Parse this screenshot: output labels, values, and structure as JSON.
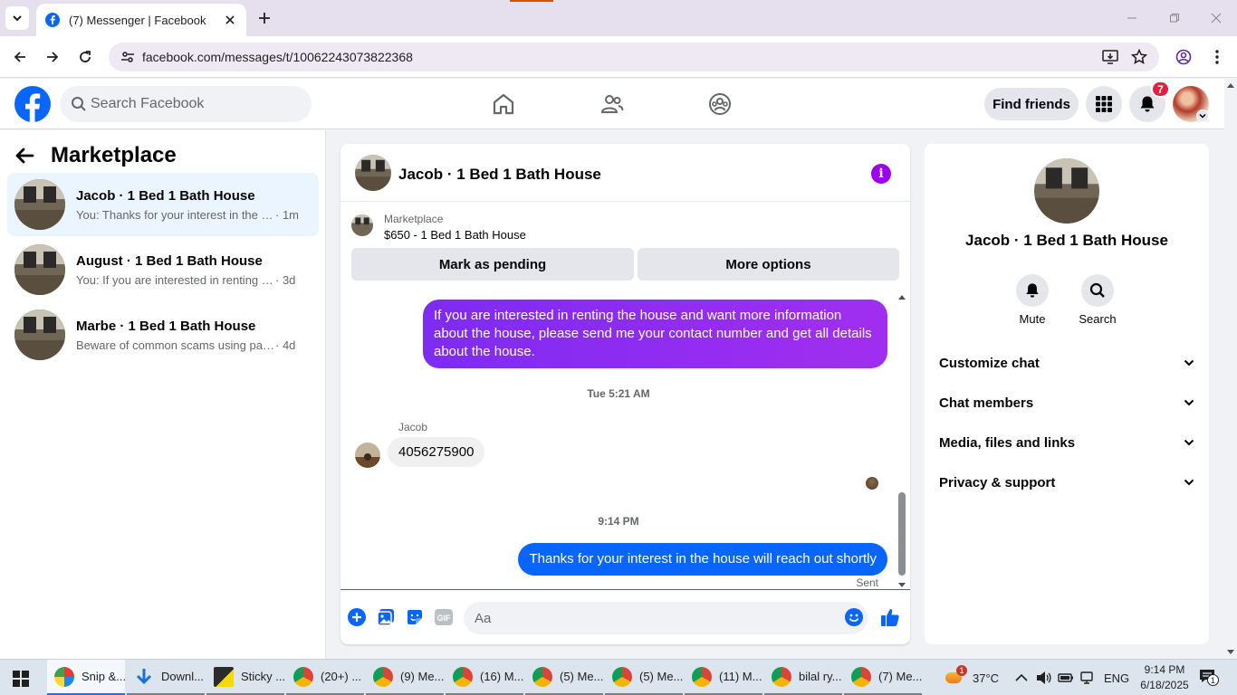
{
  "browser": {
    "tab_title": "(7) Messenger | Facebook",
    "url": "facebook.com/messages/t/10062243073822368"
  },
  "header": {
    "search_placeholder": "Search Facebook",
    "find_friends_label": "Find friends",
    "notifications_count": "7"
  },
  "sidebar": {
    "title": "Marketplace",
    "conversations": [
      {
        "name": "Jacob · 1 Bed 1 Bath House",
        "snippet": "You: Thanks for your interest in the h...",
        "time": "· 1m",
        "active": true
      },
      {
        "name": "August · 1 Bed 1 Bath House",
        "snippet": "You: If you are interested in renting th...",
        "time": "· 3d",
        "active": false
      },
      {
        "name": "Marbe · 1 Bed 1 Bath House",
        "snippet": "Beware of common scams using pay...",
        "time": "· 4d",
        "active": false
      }
    ]
  },
  "chat": {
    "title": "Jacob · 1 Bed 1 Bath House",
    "listing_label": "Marketplace",
    "listing_price": "$650 - 1 Bed 1 Bath House",
    "mark_pending_label": "Mark as pending",
    "more_options_label": "More options",
    "messages": {
      "outgoing_1": "If you are interested in renting the house and want more information about the house, please send me your contact number and get all details about the house.",
      "timestamp_1": "Tue 5:21 AM",
      "incoming_sender": "Jacob",
      "incoming_1": "4056275900",
      "timestamp_2": "9:14 PM",
      "outgoing_2": "Thanks for your interest in the house will reach out shortly",
      "status": "Sent"
    },
    "composer_placeholder": "Aa"
  },
  "details": {
    "name": "Jacob · 1 Bed 1 Bath House",
    "mute_label": "Mute",
    "search_label": "Search",
    "sections": [
      "Customize chat",
      "Chat members",
      "Media, files and links",
      "Privacy & support"
    ]
  },
  "taskbar": {
    "items": [
      "Snip &...",
      "Downl...",
      "Sticky ...",
      "(20+) ...",
      "(9) Me...",
      "(16) M...",
      "(5) Me...",
      "(5) Me...",
      "(11) M...",
      "bilal ry...",
      "(7) Me..."
    ],
    "weather": "37°C",
    "weather_badge": "1",
    "language": "ENG",
    "time": "9:14 PM",
    "date": "6/18/2025",
    "notification_count": "1"
  },
  "colors": {
    "facebook_blue": "#0866ff",
    "message_purple": "#a12ef0",
    "info_purple": "#9b00e8",
    "badge_red": "#e41e3f"
  }
}
